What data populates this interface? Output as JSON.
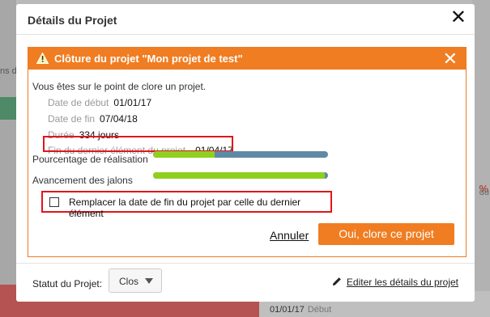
{
  "background": {
    "left_text": "ns d",
    "right_percent": "%",
    "right_text": "du",
    "bottom_date": "01/01/17",
    "bottom_date_label": "Début"
  },
  "dialog": {
    "title": "Détails du Projet",
    "close_icon": "close-icon",
    "footer": {
      "statut_label": "Statut du Projet:",
      "statut_value": "Clos",
      "edit_link": "Editer les détails du projet"
    }
  },
  "modal": {
    "title": "Clôture du projet \"Mon projet de test\"",
    "warning_icon": "warning-icon",
    "intro": "Vous êtes sur le point de clore un projet.",
    "fields": [
      {
        "label": "Date de début",
        "value": "01/01/17"
      },
      {
        "label": "Date de fin",
        "value": "07/04/18"
      },
      {
        "label": "Durée",
        "value": "334 jours"
      },
      {
        "label": "Fin du dernier élément du projet",
        "value": "01/04/17"
      }
    ],
    "metrics": [
      {
        "label": "Pourcentage de réalisation",
        "progress": 0.35
      },
      {
        "label": "Avancement des jalons",
        "progress": 0.98
      }
    ],
    "checkbox_label": "Remplacer la date de fin du projet par celle du dernier élément",
    "checkbox_checked": false,
    "cancel_label": "Annuler",
    "confirm_label": "Oui, clore ce projet",
    "colors": {
      "accent": "#f07d22",
      "highlight": "#e0161b",
      "progress_fill": "#8fd01e",
      "progress_track": "#5f8aa6"
    }
  }
}
